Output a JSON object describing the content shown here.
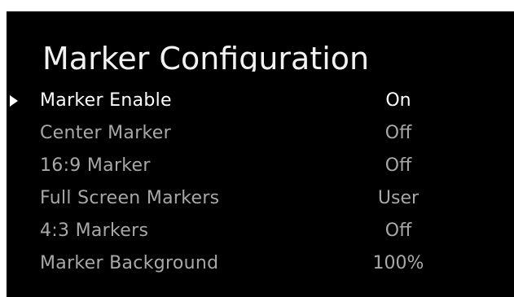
{
  "menu": {
    "title": "Marker Configuration",
    "items": [
      {
        "label": "Marker Enable",
        "value": "On"
      },
      {
        "label": "Center Marker",
        "value": "Off"
      },
      {
        "label": "16:9 Marker",
        "value": "Off"
      },
      {
        "label": "Full Screen Markers",
        "value": "User"
      },
      {
        "label": "4:3 Markers",
        "value": "Off"
      },
      {
        "label": "Marker Background",
        "value": "100%"
      }
    ],
    "selected_index": 0,
    "icons": {
      "selection_cursor": "triangle-right-icon"
    },
    "colors": {
      "background": "#000000",
      "selected_text": "#ffffff",
      "unselected_text": "#a8a8a8"
    }
  }
}
